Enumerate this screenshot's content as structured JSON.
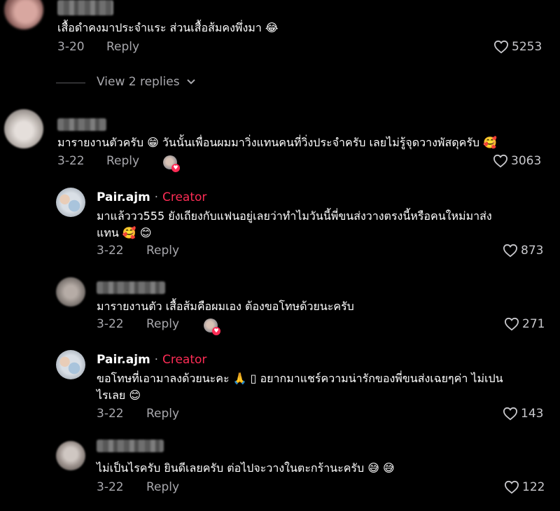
{
  "comments": [
    {
      "text": "เสื้อดำคงมาประจำแระ ส่วนเสื้อส้มคงพึ่งมา 😂",
      "date": "3-20",
      "reply_label": "Reply",
      "likes": "5253"
    },
    {
      "text": "มารายงานตัวครับ 😁 วันนั้นเพื่อนผมมาวิ่งแทนคนที่วิ่งประจำครับ เลยไม่รู้จุดวางพัสดุครับ 🥰",
      "date": "3-22",
      "reply_label": "Reply",
      "likes": "3063"
    },
    {
      "author": "Pair.ajm",
      "separator": "·",
      "role": "Creator",
      "text_line1": "มาแล้ววว555 ยังเถียงกับแฟนอยู่เลยว่าทำไมวันนี้พี่ขนส่งวางตรงนี้หรือคนใหม่มาส่ง",
      "text_line2": "แทน 🥰 😊",
      "date": "3-22",
      "reply_label": "Reply",
      "likes": "873"
    },
    {
      "text": "มารายงานตัว เสื้อส้มคือผมเอง ต้องขอโทษด้วยนะครับ",
      "date": "3-22",
      "reply_label": "Reply",
      "likes": "271"
    },
    {
      "author": "Pair.ajm",
      "separator": "·",
      "role": "Creator",
      "text_line1": "ขอโทษที่เอามาลงด้วยนะคะ 🙏 ▯ อยากมาแชร์ความน่ารักของพี่ขนส่งเฉยๆค่า ไม่เปน",
      "text_line2": "ไรเลย 😊",
      "date": "3-22",
      "reply_label": "Reply",
      "likes": "143"
    },
    {
      "text": "ไม่เป็นไรครับ ยินดีเลยครับ ต่อไปจะวางในตะกร้านะครับ 😅 😅",
      "date": "3-22",
      "reply_label": "Reply",
      "likes": "122"
    }
  ],
  "view_replies": "View 2 replies",
  "icons": {
    "like": "heart-outline-icon",
    "chevron": "chevron-down-icon"
  },
  "colors": {
    "background": "#000000",
    "text": "#ffffff",
    "muted": "#a8a8ad",
    "creator": "#fe2c55"
  }
}
